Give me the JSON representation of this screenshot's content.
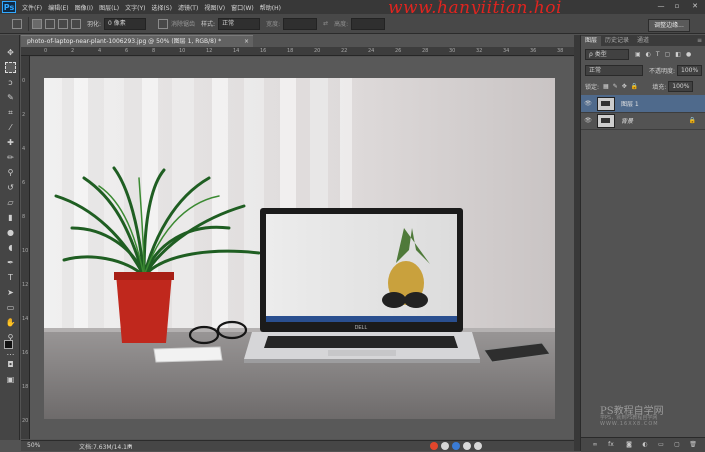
{
  "app": {
    "logo": "Ps"
  },
  "menu": [
    "文件(F)",
    "编辑(E)",
    "图像(I)",
    "图层(L)",
    "文字(Y)",
    "选择(S)",
    "滤镜(T)",
    "视图(V)",
    "窗口(W)",
    "帮助(H)"
  ],
  "watermark_top": "www.hanyiitian.hoi",
  "options": {
    "feather_label": "羽化:",
    "feather_value": "0 像素",
    "antialias_label": "消除锯齿",
    "style_label": "样式:",
    "style_value": "正常",
    "width_label": "宽度:",
    "height_label": "高度:",
    "refine_edge": "调整边缘..."
  },
  "document": {
    "tab_title": "photo-of-laptop-near-plant-1006293.jpg @ 50% (图层 1, RGB/8) *",
    "close": "×",
    "zoom": "50%",
    "doc_size": "文档:7.63M/14.1M",
    "photo_brand": "DELL"
  },
  "ruler": {
    "top_ticks": [
      "0",
      "2",
      "4",
      "6",
      "8",
      "10",
      "12",
      "14",
      "16",
      "18",
      "20",
      "22",
      "24",
      "26",
      "28",
      "30",
      "32",
      "34",
      "36",
      "38"
    ],
    "left_ticks": [
      "0",
      "2",
      "4",
      "6",
      "8",
      "10",
      "12",
      "14",
      "16",
      "18",
      "20"
    ]
  },
  "layers_panel": {
    "tabs": [
      "图层",
      "历史记录",
      "通道"
    ],
    "filter_kind": "ρ 类型",
    "blend_mode": "正常",
    "opacity_label": "不透明度:",
    "opacity_value": "100%",
    "lock_label": "锁定:",
    "fill_label": "填充:",
    "fill_value": "100%",
    "layers": [
      {
        "name": "图层 1",
        "selected": true,
        "visible": true
      },
      {
        "name": "背景",
        "selected": false,
        "visible": true,
        "locked": true
      }
    ]
  },
  "watermark_bottom": {
    "title": "PS教程自学网",
    "sub1": "学PS，就到PS教程自学网",
    "sub2": "WWW.16XX8.COM"
  },
  "colors": {
    "accent": "#31a8ff",
    "watermark_red": "#e0241f",
    "panel_bg": "#535353",
    "selected_layer": "#4f6a8c"
  }
}
